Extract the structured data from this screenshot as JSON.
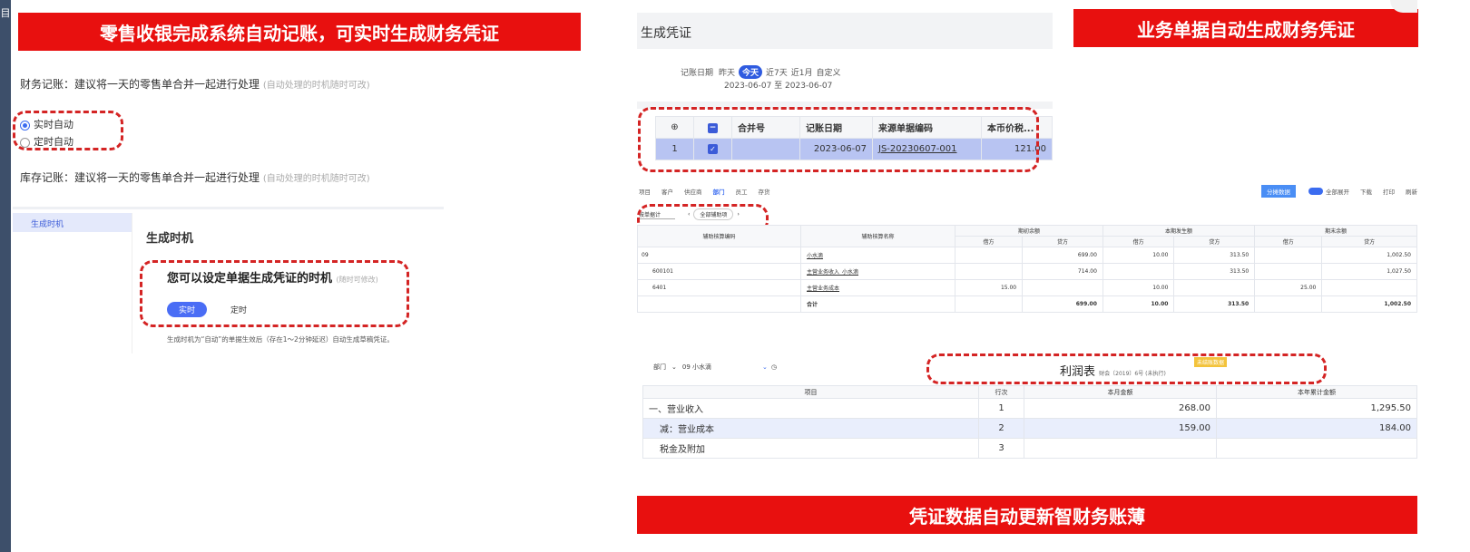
{
  "left_strip_char": "目",
  "left": {
    "banner": "零售收银完成系统自动记账，可实时生成财务凭证",
    "fin_label": "财务记账：建议将一天的零售单合并一起进行处理",
    "fin_hint": "(自动处理的时机随时可改)",
    "radio_realtime": "实时自动",
    "radio_timed": "定时自动",
    "inv_label": "库存记账：建议将一天的零售单合并一起进行处理",
    "inv_hint": "(自动处理的时机随时可改)",
    "nav_item": "生成时机",
    "panel_title": "生成时机",
    "timing_title": "您可以设定单据生成凭证的时机",
    "timing_hint": "(随时可修改)",
    "btn_realtime": "实时",
    "btn_timed": "定时",
    "footnote": "生成时机为“自动”的单据生效后（存在1～2分钟延迟）自动生成草稿凭证。"
  },
  "right": {
    "banner_top": "业务单据自动生成财务凭证",
    "banner_bottom": "凭证数据自动更新智财务账薄",
    "voucher": {
      "title": "生成凭证",
      "date_label": "记账日期",
      "date_opts": [
        "昨天",
        "今天",
        "近7天",
        "近1月",
        "自定义"
      ],
      "date_active": "今天",
      "date_range": "2023-06-07 至 2023-06-07",
      "headers": [
        "合并号",
        "记账日期",
        "来源单据编码",
        "本币价税..."
      ],
      "row": {
        "idx": "1",
        "date": "2023-06-07",
        "code": "JS-20230607-001",
        "amount": "121.00"
      }
    },
    "ledger": {
      "tabs": [
        "项目",
        "客户",
        "供应商",
        "部门",
        "员工",
        "存货"
      ],
      "active_tab": "部门",
      "right_btn": "分摊数据",
      "right_opts": [
        "全部展开",
        "下载",
        "打印",
        "刷新"
      ],
      "filter_sel": "按单据计",
      "filter_mid": "全部辅助项",
      "head_code": "辅助核算编码",
      "head_name": "辅助核算名称",
      "groups": [
        "期初余额",
        "本期发生额",
        "期末余额"
      ],
      "sub": [
        "借方",
        "贷方"
      ],
      "rows": [
        {
          "code": "09",
          "name": "小水滴",
          "v": [
            "",
            "699.00",
            "10.00",
            "313.50",
            "",
            "1,002.50"
          ]
        },
        {
          "code": "600101",
          "name": "主营业务收入_小水滴",
          "v": [
            "",
            "714.00",
            "",
            "313.50",
            "",
            "1,027.50"
          ]
        },
        {
          "code": "6401",
          "name": "主营业务成本",
          "v": [
            "15.00",
            "",
            "10.00",
            "",
            "25.00",
            ""
          ]
        }
      ],
      "total_label": "合计",
      "total": [
        "",
        "699.00",
        "10.00",
        "313.50",
        "",
        "1,002.50"
      ]
    },
    "profit": {
      "dept_label": "部门",
      "dept_value": "09 小水滴",
      "title": "利润表",
      "subtitle": "财会〔2019〕6号 (未执行)",
      "badge": "未结账数据",
      "headers": [
        "项目",
        "行次",
        "本月金额",
        "本年累计金额"
      ],
      "rows": [
        {
          "item": "一、营业收入",
          "line": "1",
          "month": "268.00",
          "year": "1,295.50"
        },
        {
          "item": "减：营业成本",
          "line": "2",
          "month": "159.00",
          "year": "184.00"
        },
        {
          "item": "税金及附加",
          "line": "3",
          "month": "",
          "year": ""
        }
      ]
    }
  },
  "colors": {
    "banner_red": "#e8100f",
    "dash_red": "#d42424",
    "accent_blue": "#3b6cf0",
    "row_highlight": "#b8c4f2"
  }
}
